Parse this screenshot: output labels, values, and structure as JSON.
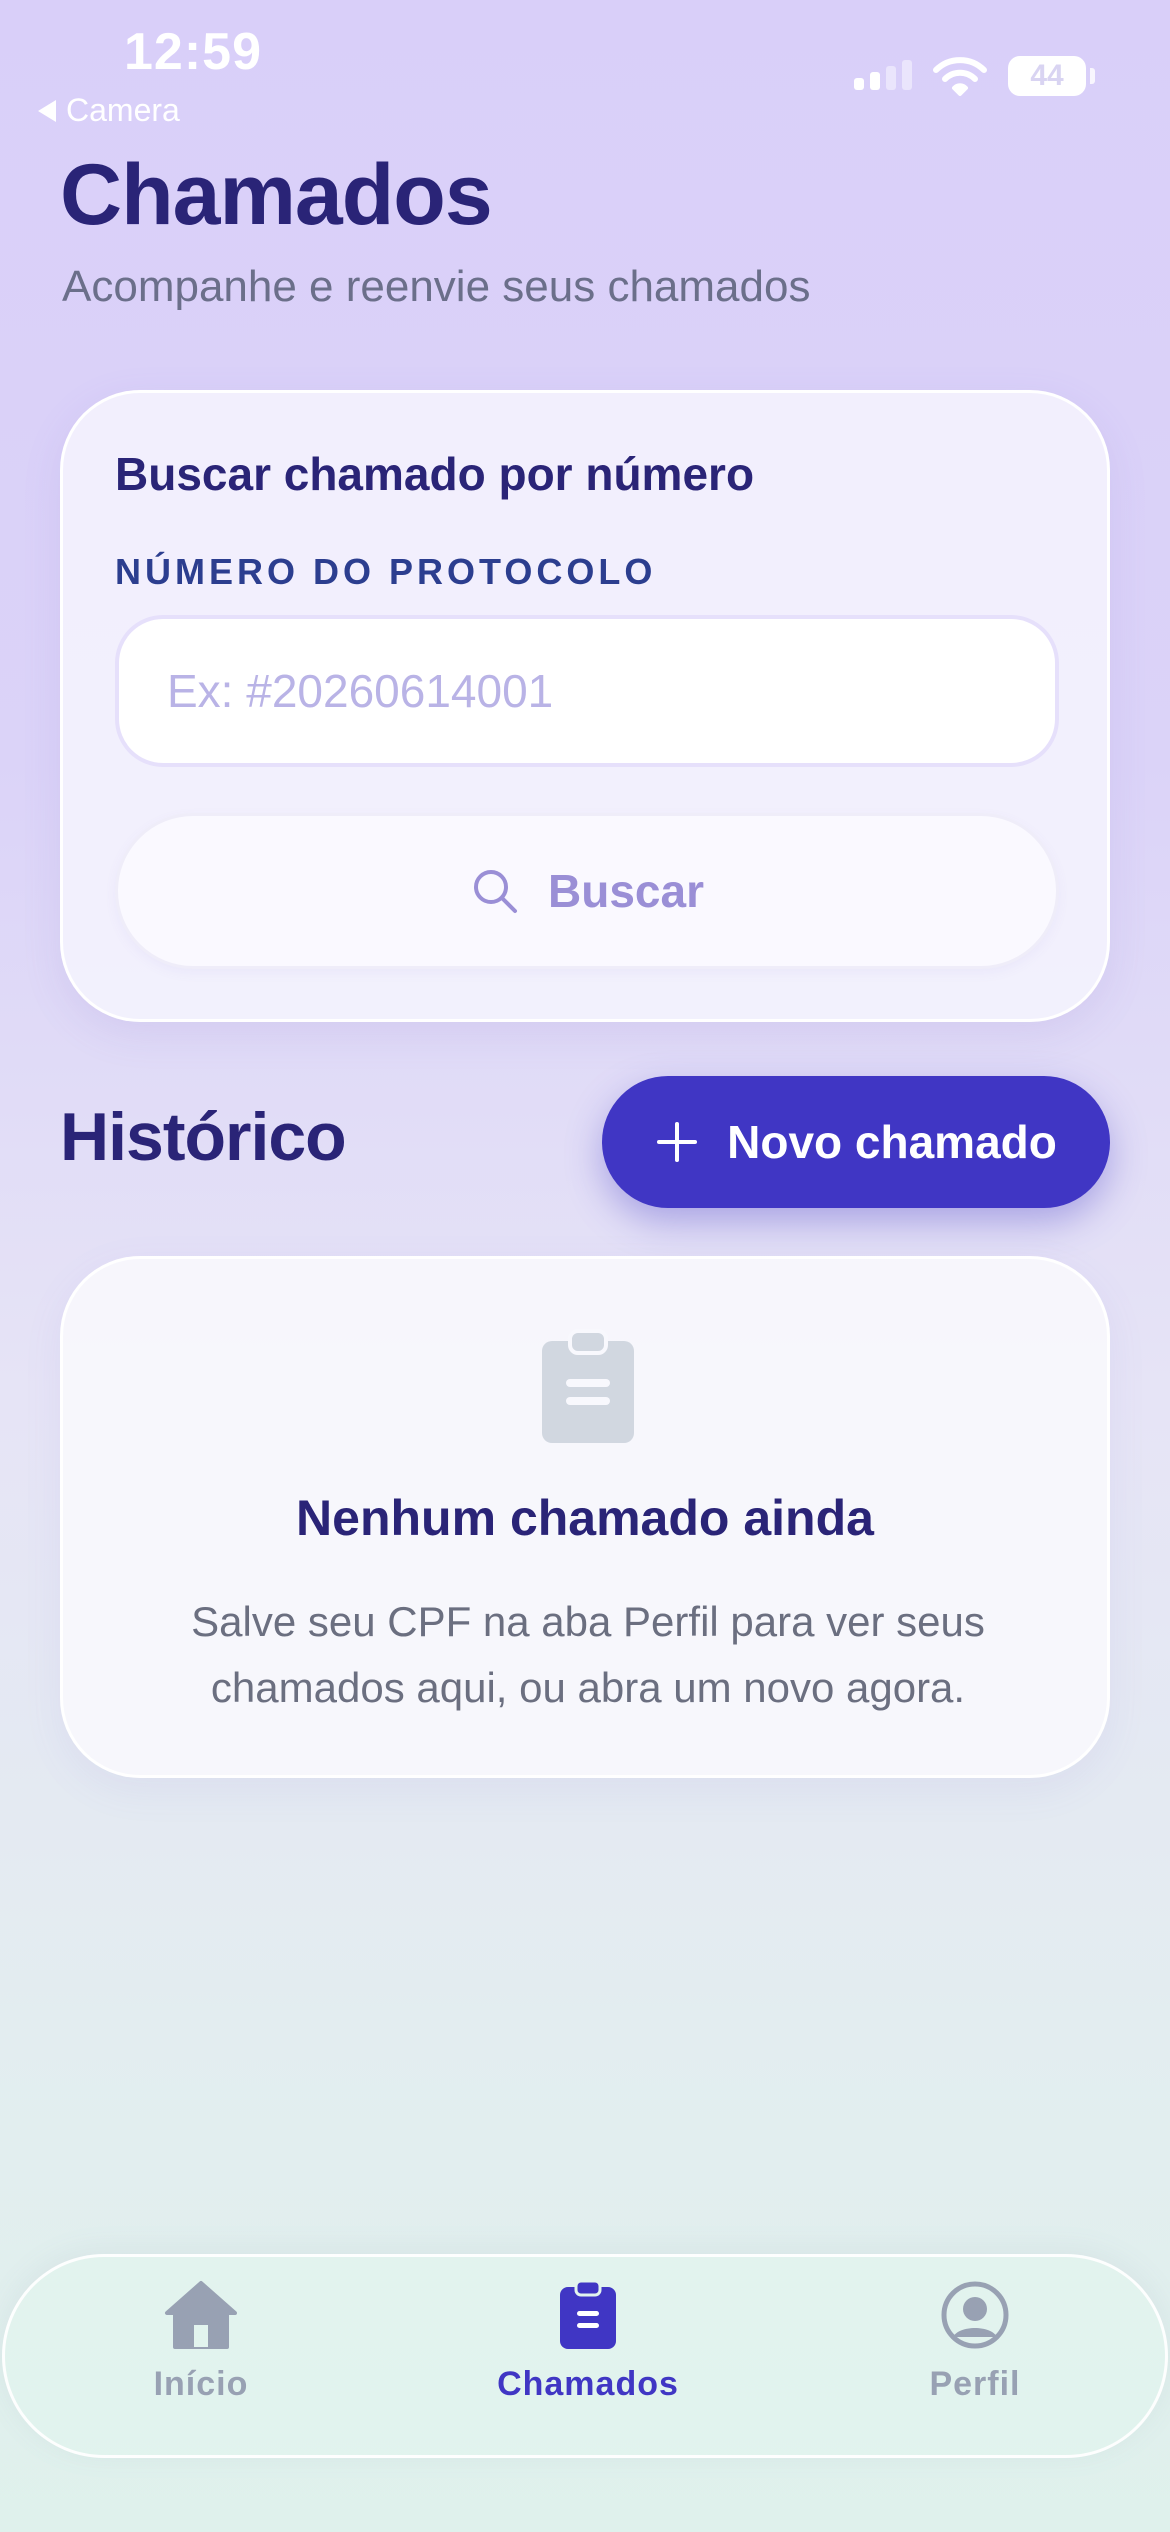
{
  "status_bar": {
    "time": "12:59",
    "back_label": "Camera",
    "battery": "44"
  },
  "header": {
    "title": "Chamados",
    "subtitle": "Acompanhe e reenvie seus chamados"
  },
  "search_card": {
    "title": "Buscar chamado por número",
    "field_label": "NÚMERO DO PROTOCOLO",
    "input_value": "",
    "input_placeholder": "Ex: #20260614001",
    "button_label": "Buscar"
  },
  "history": {
    "title": "Histórico",
    "new_button_label": "Novo chamado",
    "empty_title": "Nenhum chamado ainda",
    "empty_description": "Salve seu CPF na aba Perfil para ver seus chamados aqui, ou abra um novo agora."
  },
  "tab_bar": {
    "items": [
      {
        "label": "Início",
        "icon": "home-icon",
        "active": false
      },
      {
        "label": "Chamados",
        "icon": "clipboard-icon",
        "active": true
      },
      {
        "label": "Perfil",
        "icon": "profile-icon",
        "active": false
      }
    ]
  },
  "colors": {
    "primary": "#4036c4",
    "heading": "#2a2477",
    "label_blue": "#2c3e8f",
    "muted_text": "#6b6f8a",
    "inactive_tab": "#98a1b3",
    "empty_icon": "#d1d7e0"
  }
}
